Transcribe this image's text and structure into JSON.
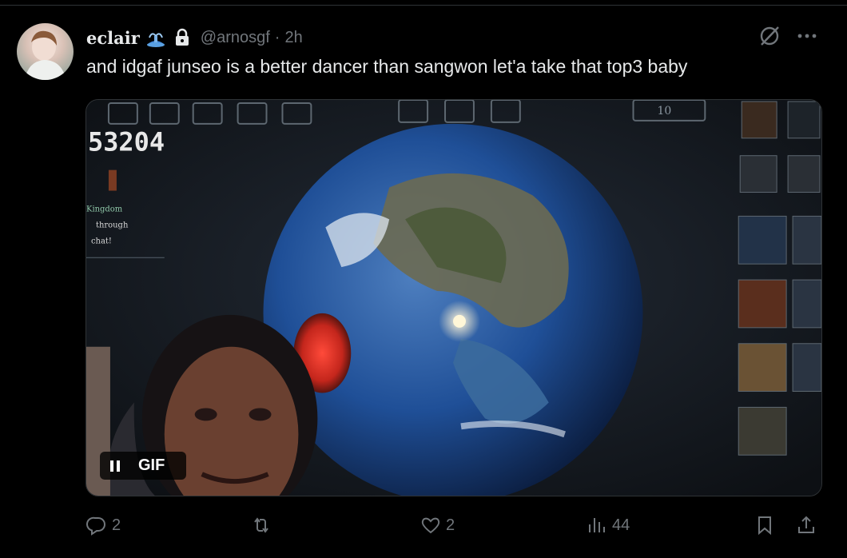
{
  "tweet": {
    "display_name": "eclair",
    "name_emoji": "fountain-emoji",
    "locked_icon": "lock-icon",
    "handle": "@arnosgf",
    "separator": "·",
    "time": "2h",
    "text": "and idgaf junseo is a better dancer than sangwon let'a take that top3 baby",
    "header_icons": [
      "grok-icon",
      "more-icon"
    ]
  },
  "media": {
    "type": "gif",
    "badge_label": "GIF",
    "pause_icon": "pause-icon",
    "overlay_score": "53204",
    "overlay_hud_left": [
      "Kingdom",
      "through",
      "chat!"
    ],
    "overlay_hud_top_right": "10"
  },
  "actions": {
    "reply_count": "2",
    "repost_count": "",
    "like_count": "2",
    "views_count": "44",
    "icons": [
      "reply-icon",
      "repost-icon",
      "like-icon",
      "views-icon",
      "bookmark-icon",
      "share-icon"
    ]
  },
  "colors": {
    "background": "#000000",
    "text_primary": "#e7e9ea",
    "text_secondary": "#71767b",
    "divider": "#2f3336"
  }
}
